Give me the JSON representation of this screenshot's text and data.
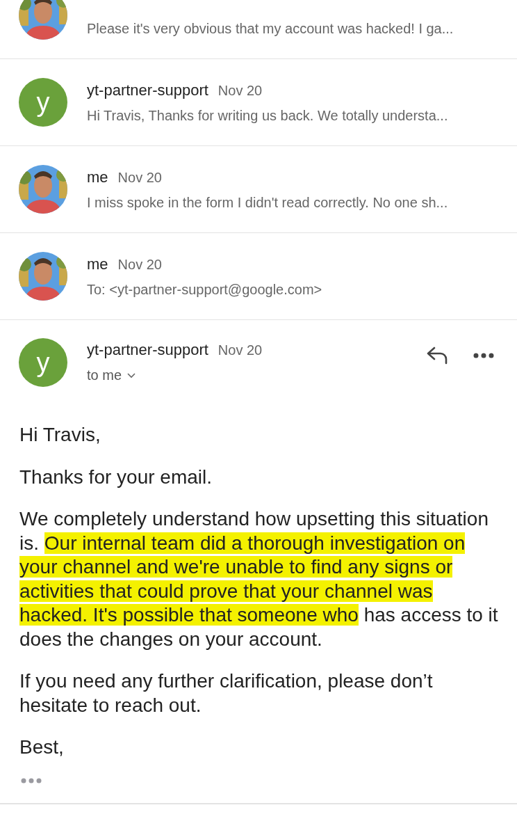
{
  "thread": [
    {
      "preview": "Please it's very obvious that my account was hacked! I ga..."
    },
    {
      "avatar": {
        "kind": "letter",
        "letter": "y",
        "color": "#6aa13b"
      },
      "sender": "yt-partner-support",
      "date": "Nov 20",
      "preview": "Hi Travis, Thanks for writing us back. We totally understa..."
    },
    {
      "sender": "me",
      "date": "Nov 20",
      "preview": "I miss spoke in the form I didn't read correctly. No one sh..."
    },
    {
      "sender": "me",
      "date": "Nov 20",
      "preview": "To: <yt-partner-support@google.com>"
    }
  ],
  "open_message": {
    "avatar": {
      "kind": "letter",
      "letter": "y",
      "color": "#6aa13b"
    },
    "sender": "yt-partner-support",
    "date": "Nov 20",
    "recipient": "to me",
    "body": [
      [
        {
          "text": "Hi Travis,",
          "highlighted": false
        }
      ],
      [
        {
          "text": "Thanks for your email.",
          "highlighted": false
        }
      ],
      [
        {
          "text": "We completely understand how upsetting this situation is. ",
          "highlighted": false
        },
        {
          "text": "Our internal team did a thorough investigation on your channel and we're unable to find any signs or activities that could prove that your channel was hacked. It's possible that someone who",
          "highlighted": true
        },
        {
          "text": " has access to it does the changes on your account.",
          "highlighted": false
        }
      ],
      [
        {
          "text": "If you need any further clarification, please don’t hesitate to reach out.",
          "highlighted": false
        }
      ],
      [
        {
          "text": "Best,",
          "highlighted": false
        }
      ]
    ]
  }
}
